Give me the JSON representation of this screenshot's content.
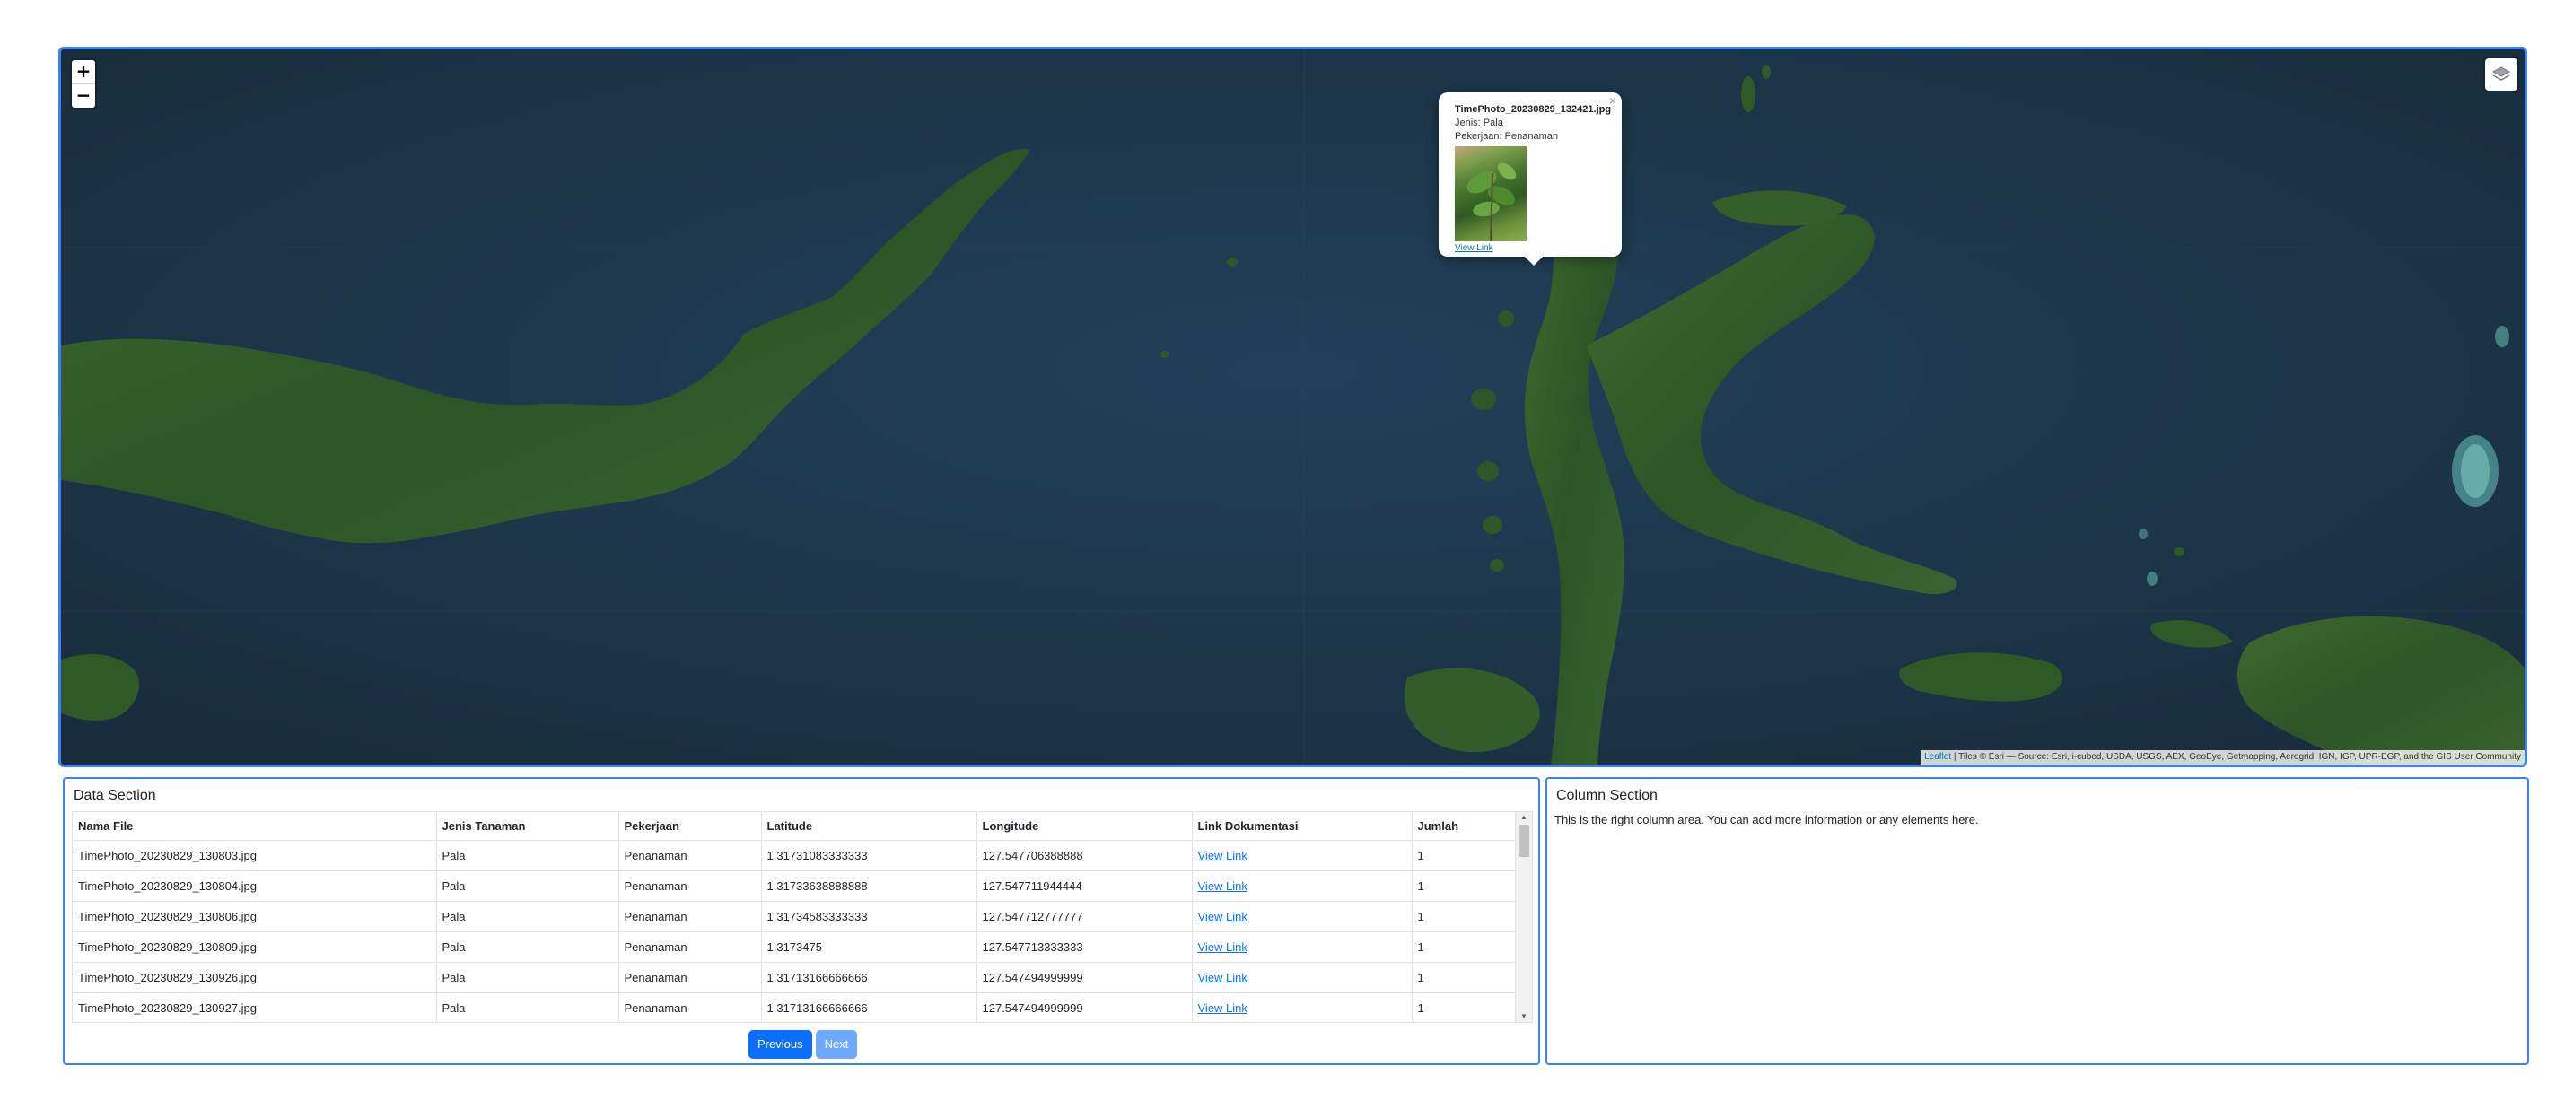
{
  "map": {
    "zoom_in": "+",
    "zoom_out": "−",
    "attribution_leaflet": "Leaflet",
    "attribution_text": " | Tiles © Esri — Source: Esri, i-cubed, USDA, USGS, AEX, GeoEye, Getmapping, Aerogrid, IGN, IGP, UPR-EGP, and the GIS User Community",
    "layers_icon": "layers-icon",
    "popup": {
      "title": "TimePhoto_20230829_132421.jpg",
      "jenis": "Jenis: Pala",
      "pekerjaan": "Pekerjaan: Penanaman",
      "link_label": "View Link",
      "close": "×"
    }
  },
  "data_section": {
    "title": "Data Section",
    "columns": [
      "Nama File",
      "Jenis Tanaman",
      "Pekerjaan",
      "Latitude",
      "Longitude",
      "Link Dokumentasi",
      "Jumlah"
    ],
    "rows": [
      [
        "TimePhoto_20230829_130803.jpg",
        "Pala",
        "Penanaman",
        "1.31731083333333",
        "127.547706388888",
        "View Link",
        "1"
      ],
      [
        "TimePhoto_20230829_130804.jpg",
        "Pala",
        "Penanaman",
        "1.31733638888888",
        "127.547711944444",
        "View Link",
        "1"
      ],
      [
        "TimePhoto_20230829_130806.jpg",
        "Pala",
        "Penanaman",
        "1.31734583333333",
        "127.547712777777",
        "View Link",
        "1"
      ],
      [
        "TimePhoto_20230829_130809.jpg",
        "Pala",
        "Penanaman",
        "1.3173475",
        "127.547713333333",
        "View Link",
        "1"
      ],
      [
        "TimePhoto_20230829_130926.jpg",
        "Pala",
        "Penanaman",
        "1.31713166666666",
        "127.547494999999",
        "View Link",
        "1"
      ],
      [
        "TimePhoto_20230829_130927.jpg",
        "Pala",
        "Penanaman",
        "1.31713166666666",
        "127.547494999999",
        "View Link",
        "1"
      ]
    ],
    "prev_label": "Previous",
    "next_label": "Next"
  },
  "column_section": {
    "title": "Column Section",
    "text": "This is the right column area. You can add more information or any elements here."
  },
  "colors": {
    "accent": "#3b82f6",
    "primary_button": "#0d6efd",
    "disabled_button": "#6ea8fe",
    "link": "#0d6efd",
    "ocean": "#1d3444",
    "land": "#2f5a2a"
  }
}
